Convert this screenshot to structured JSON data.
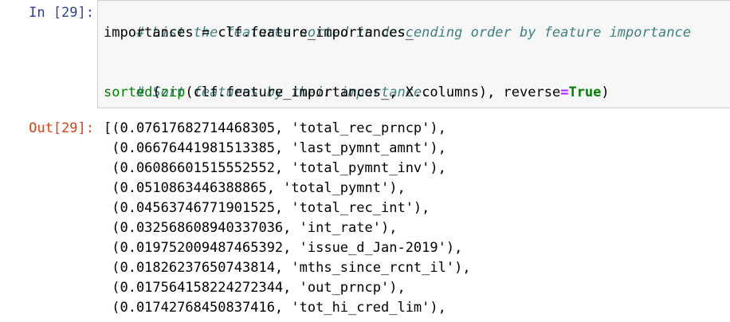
{
  "input_cell": {
    "prompt": "In [29]:",
    "lines": {
      "comment1": "# List the features sorted in descending order by feature importance",
      "assign_var": "importances",
      "assign_op": " = ",
      "assign_rhs": "clf.feature_importances_",
      "comment2": "# Sort features by their importance.",
      "call_sorted": "sorted",
      "call_open1": "(",
      "call_zip": "zip",
      "call_args": "(clf.feature_importances_, X.columns), reverse",
      "call_eq": "=",
      "call_true": "True",
      "call_close": ")"
    }
  },
  "output_cell": {
    "prompt": "Out[29]:",
    "lines": [
      "[(0.07617682714468305, 'total_rec_prncp'),",
      " (0.06676441981513385, 'last_pymnt_amnt'),",
      " (0.06086601515552552, 'total_pymnt_inv'),",
      " (0.0510863446388865, 'total_pymnt'),",
      " (0.04563746771901525, 'total_rec_int'),",
      " (0.032568608940337036, 'int_rate'),",
      " (0.019752009487465392, 'issue_d_Jan-2019'),",
      " (0.01826237650743814, 'mths_since_rcnt_il'),",
      " (0.017564158224272344, 'out_prncp'),",
      " (0.01742768450837416, 'tot_hi_cred_lim'),"
    ]
  }
}
